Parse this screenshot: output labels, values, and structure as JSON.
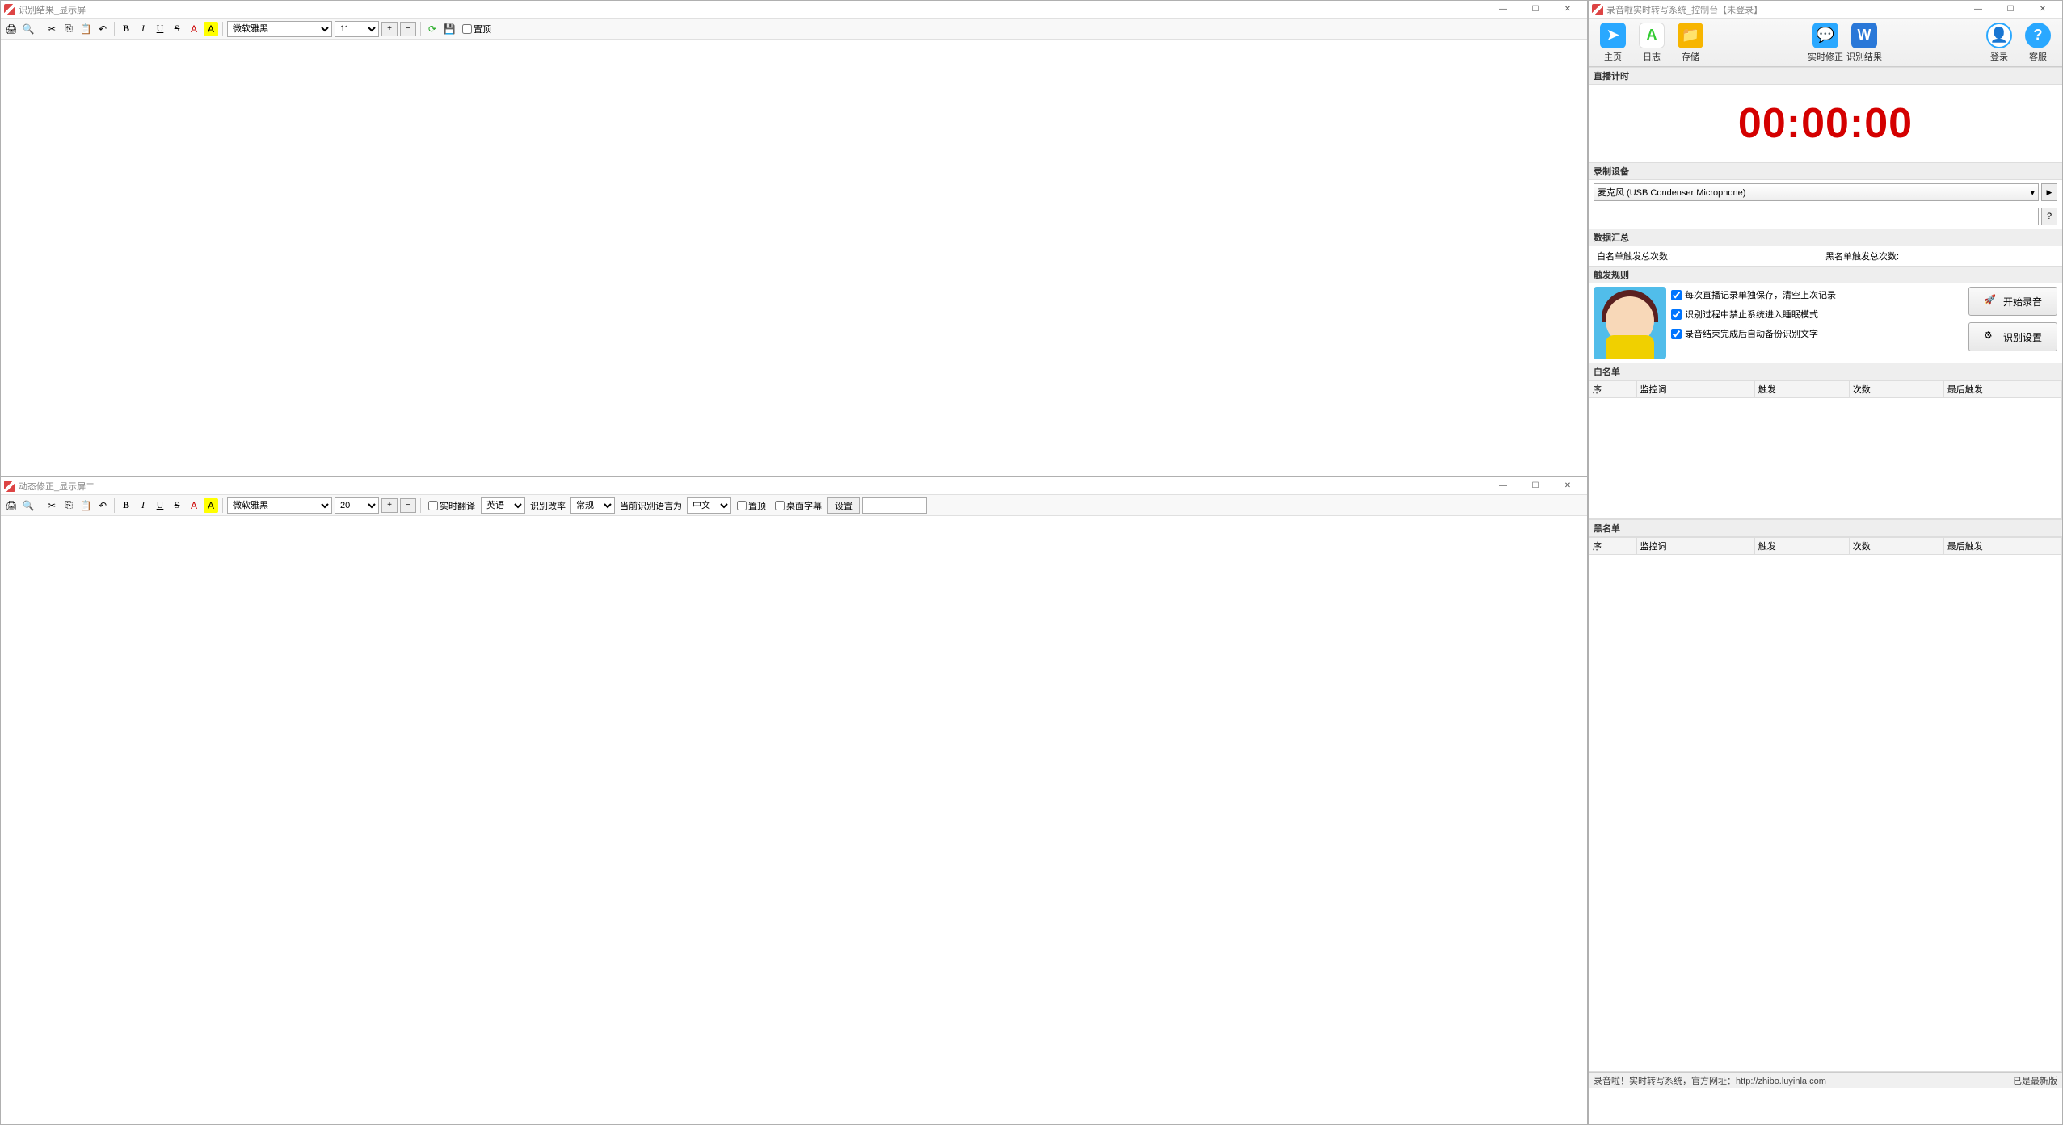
{
  "window1": {
    "title": "识别结果_显示屏",
    "toolbar": {
      "font": "微软雅黑",
      "size": "11",
      "overlay_label": "置顶"
    }
  },
  "window2": {
    "title": "动态修正_显示屏二",
    "toolbar": {
      "font": "微软雅黑",
      "size": "20",
      "realtime_translate": "实时翻译",
      "lang_src": "英语",
      "rate_label": "识别改率",
      "rate_val": "常规",
      "current_lang_label": "当前识别语言为",
      "lang_cur": "中文",
      "overlay_label": "置顶",
      "desktop_sub": "桌面字幕",
      "settings": "设置"
    }
  },
  "control": {
    "title": "录音啦实时转写系统_控制台【未登录】",
    "nav": {
      "home": "主页",
      "log": "日志",
      "save": "存储",
      "realtime": "实时修正",
      "result": "识别结果",
      "login": "登录",
      "support": "客服"
    },
    "timer_hdr": "直播计时",
    "timer": "00:00:00",
    "device_hdr": "录制设备",
    "device": "麦克风 (USB Condenser Microphone)",
    "stats_hdr": "数据汇总",
    "stat_white": "白名单触发总次数:",
    "stat_black": "黑名单触发总次数:",
    "rules_hdr": "触发规则",
    "rule1": "每次直播记录单独保存，清空上次记录",
    "rule2": "识别过程中禁止系统进入睡眠模式",
    "rule3": "录音结束完成后自动备份识别文字",
    "btn_start": "开始录音",
    "btn_settings": "识别设置",
    "whitelist_hdr": "白名单",
    "blacklist_hdr": "黑名单",
    "cols": {
      "seq": "序",
      "keyword": "监控词",
      "trigger": "触发",
      "count": "次数",
      "last": "最后触发"
    },
    "status_left": "录音啦！实时转写系统，官方网址：http://zhibo.luyinla.com",
    "status_right": "已是最新版"
  }
}
